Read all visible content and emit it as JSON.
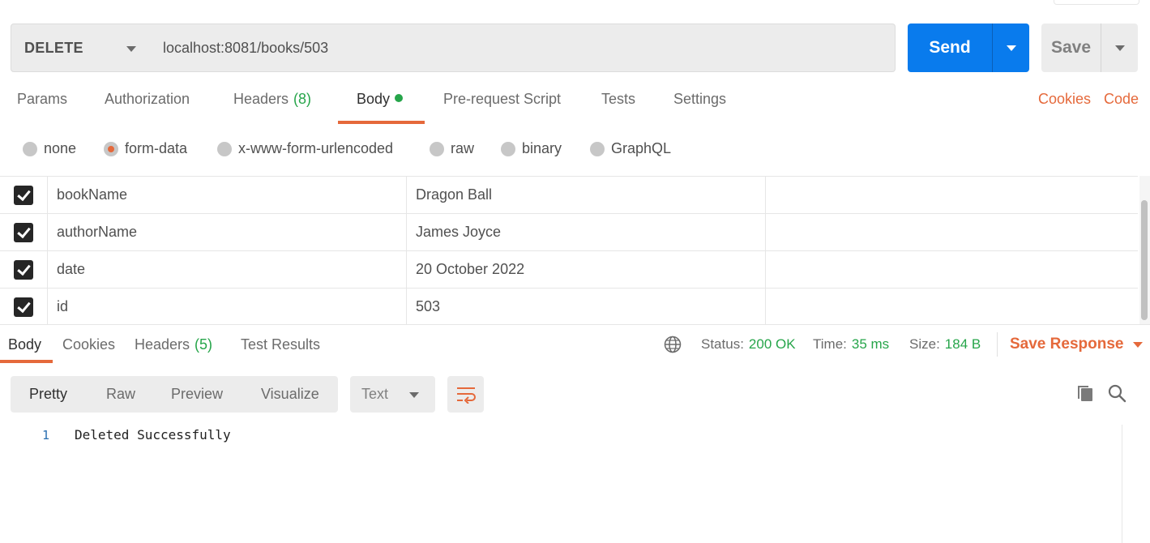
{
  "request": {
    "method": "DELETE",
    "url": "localhost:8081/books/503",
    "send_label": "Send",
    "save_label": "Save"
  },
  "request_tabs": [
    {
      "label": "Params"
    },
    {
      "label": "Authorization"
    },
    {
      "label": "Headers",
      "count": "(8)"
    },
    {
      "label": "Body"
    },
    {
      "label": "Pre-request Script"
    },
    {
      "label": "Tests"
    },
    {
      "label": "Settings"
    }
  ],
  "active_request_tab": "Body",
  "right_links": {
    "cookies": "Cookies",
    "code": "Code"
  },
  "body_types": [
    {
      "label": "none"
    },
    {
      "label": "form-data"
    },
    {
      "label": "x-www-form-urlencoded"
    },
    {
      "label": "raw"
    },
    {
      "label": "binary"
    },
    {
      "label": "GraphQL"
    }
  ],
  "selected_body_type": "form-data",
  "form_rows": [
    {
      "checked": true,
      "key": "bookName",
      "value": "Dragon Ball"
    },
    {
      "checked": true,
      "key": "authorName",
      "value": "James Joyce"
    },
    {
      "checked": true,
      "key": "date",
      "value": "20 October 2022"
    },
    {
      "checked": true,
      "key": "id",
      "value": "503"
    }
  ],
  "response_tabs": [
    {
      "label": "Body"
    },
    {
      "label": "Cookies"
    },
    {
      "label": "Headers",
      "count": "(5)"
    },
    {
      "label": "Test Results"
    }
  ],
  "active_response_tab": "Body",
  "response_status": {
    "status_label": "Status:",
    "status_value": "200 OK",
    "time_label": "Time:",
    "time_value": "35 ms",
    "size_label": "Size:",
    "size_value": "184 B"
  },
  "save_response_label": "Save Response",
  "view_modes": [
    {
      "label": "Pretty"
    },
    {
      "label": "Raw"
    },
    {
      "label": "Preview"
    },
    {
      "label": "Visualize"
    }
  ],
  "active_view_mode": "Pretty",
  "format": "Text",
  "response_body": {
    "line_number": "1",
    "text": "Deleted Successfully"
  },
  "colors": {
    "accent": "#e5693b",
    "primary": "#097bed",
    "success": "#26a54a"
  },
  "icons": [
    "globe-icon",
    "wrap-lines-icon",
    "copy-icon",
    "search-icon",
    "chevron-down-icon",
    "checkbox-checked-icon"
  ]
}
